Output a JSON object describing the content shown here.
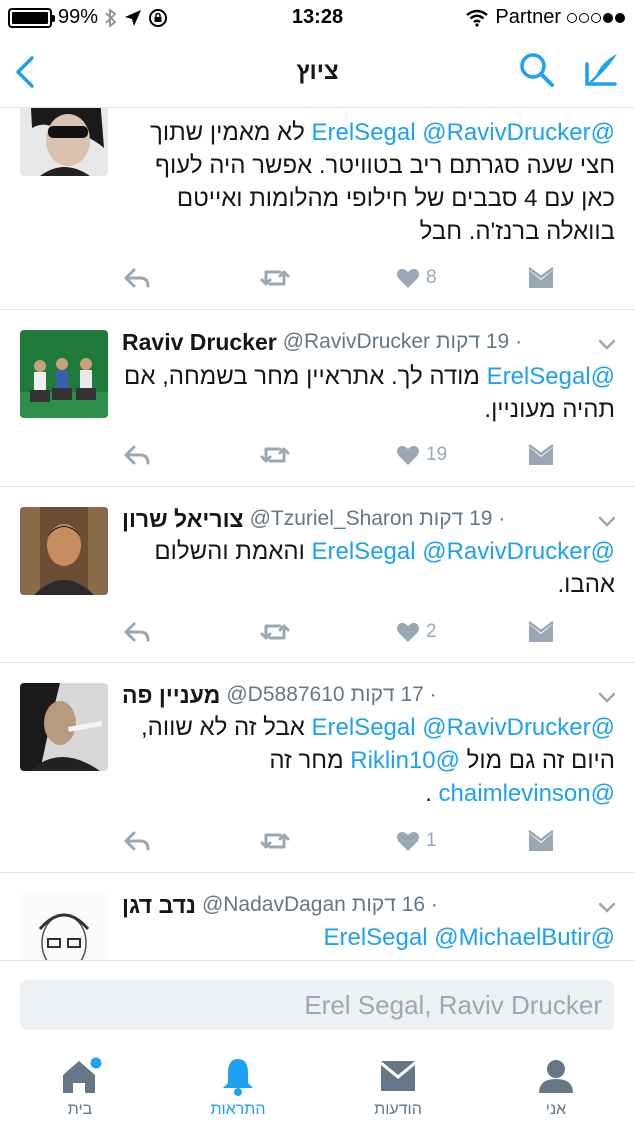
{
  "status": {
    "battery_percent": "99%",
    "battery_level": 0.99,
    "time": "13:28",
    "carrier": "Partner"
  },
  "nav": {
    "title": "ציוץ",
    "back_icon": "chevron-left-icon",
    "search_icon": "search-icon",
    "compose_icon": "compose-icon"
  },
  "tweets": [
    {
      "name": "",
      "handle": "",
      "time": "",
      "body": [
        {
          "t": "@ErelSegal @RavivDrucker",
          "m": true
        },
        {
          "t": " לא מאמין שתוך חצי שעה סגרתם ריב בטוויטר. אפשר היה לעוף כאן עם 4 סבבים של חילופי מהלומות ואייטם בוואלה ברנז'ה. חבל",
          "m": false
        }
      ],
      "likes": "8"
    },
    {
      "name": "Raviv Drucker",
      "handle": "@RavivDrucker",
      "time": "· 19 דקות",
      "body": [
        {
          "t": "@ErelSegal",
          "m": true
        },
        {
          "t": " מודה לך. אתראיין מחר בשמחה, אם תהיה מעוניין.",
          "m": false
        }
      ],
      "likes": "19"
    },
    {
      "name": "צוריאל שרון",
      "handle": "@Tzuriel_Sharon",
      "time": "· 19 דקות",
      "body": [
        {
          "t": "@ErelSegal @RavivDrucker",
          "m": true
        },
        {
          "t": " והאמת והשלום אהבו.",
          "m": false
        }
      ],
      "likes": "2"
    },
    {
      "name": "מעניין פה",
      "handle": "@D5887610",
      "time": "· 17 דקות",
      "body": [
        {
          "t": "@ErelSegal @RavivDrucker",
          "m": true
        },
        {
          "t": " אבל זה לא שווה, היום זה גם מול ",
          "m": false
        },
        {
          "t": "@Riklin10",
          "m": true
        },
        {
          "t": " מחר זה ",
          "m": false
        },
        {
          "t": "@chaimlevinson",
          "m": true
        },
        {
          "t": " .",
          "m": false
        }
      ],
      "likes": "1"
    },
    {
      "name": "נדב דגן",
      "handle": "@NadavDagan",
      "time": "· 16 דקות",
      "body": [
        {
          "t": "@ErelSegal @MichaelButir",
          "m": true
        }
      ],
      "likes": ""
    }
  ],
  "reply": {
    "placeholder": "Erel Segal, Raviv Drucker"
  },
  "tabs": [
    {
      "label": "בית",
      "icon": "home-icon"
    },
    {
      "label": "התראות",
      "icon": "bell-icon"
    },
    {
      "label": "הודעות",
      "icon": "envelope-icon"
    },
    {
      "label": "אני",
      "icon": "person-icon"
    }
  ],
  "colors": {
    "accent": "#1da1f2",
    "muted": "#9aa8b5"
  }
}
